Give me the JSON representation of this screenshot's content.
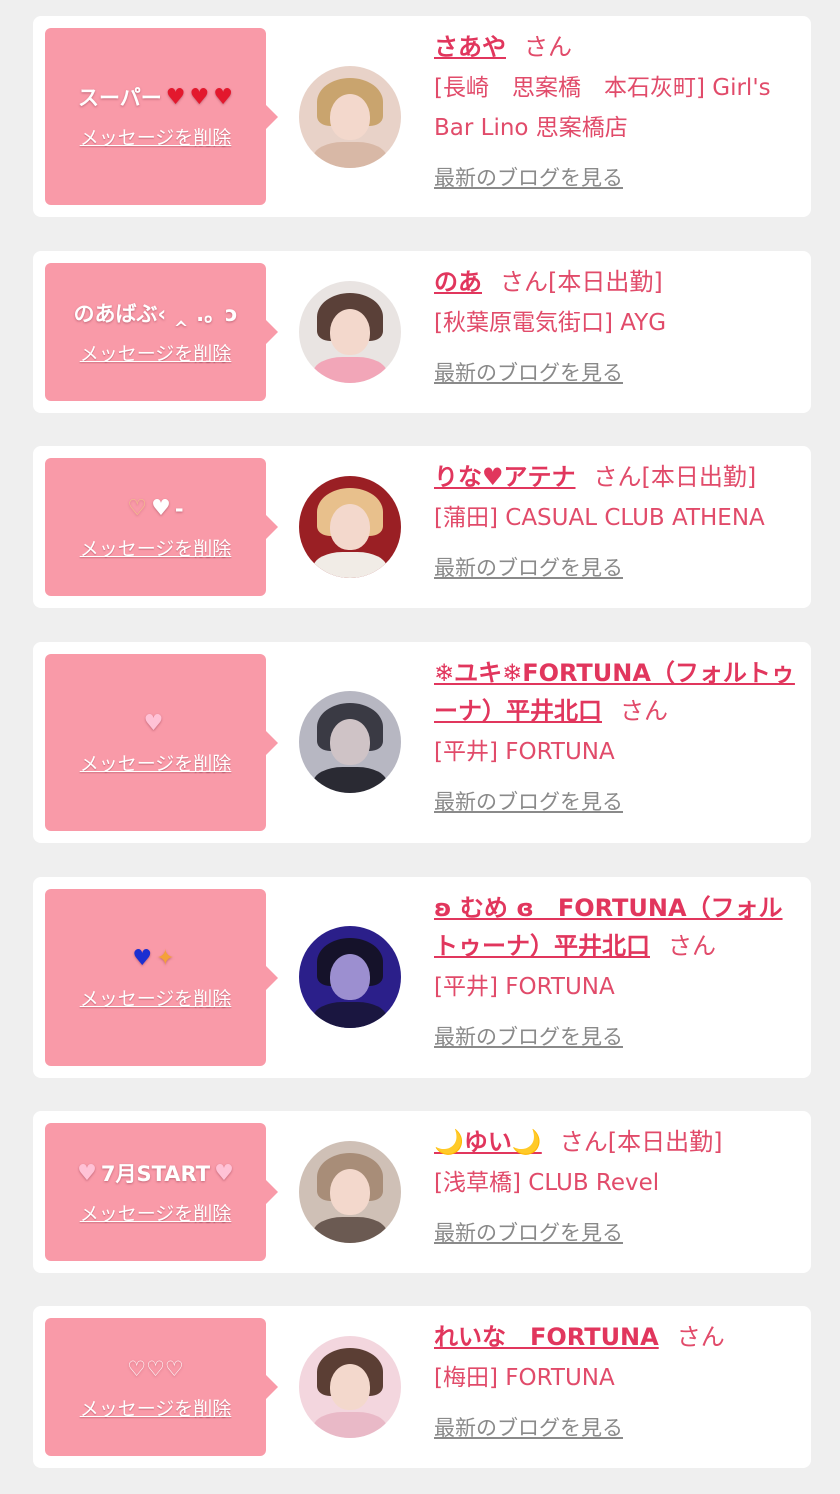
{
  "delete_label": "メッセージを削除",
  "san_label": "さん",
  "blog_label": "最新のブログを見る",
  "colors": {
    "bubble": "#f99aa8",
    "name": "#e1365d",
    "text": "#e14b6a",
    "link_gray": "#8a8a8a",
    "background": "#efefef"
  },
  "entries": [
    {
      "message_text": "スーパー",
      "message_icons": [
        "heart-icon",
        "heart-icon",
        "heart-icon"
      ],
      "name": "さあや",
      "status": "",
      "shop": "[長崎　思案橋　本石灰町] Girl's Bar Lino 思案橋店"
    },
    {
      "message_text": "のあばぶ‹ ‸ .。ↄ",
      "message_icons": [],
      "name": "のあ",
      "status": "[本日出勤]",
      "shop": "[秋葉原電気街口] AYG"
    },
    {
      "message_text": "-",
      "message_icons": [
        "heart-hands-icon",
        "white-heart-icon"
      ],
      "name": "りな♥アテナ",
      "status": "[本日出勤]",
      "shop": "[蒲田] CASUAL CLUB ATHENA"
    },
    {
      "message_text": "",
      "message_icons": [
        "pink-heart-icon"
      ],
      "name": "❄ユキ❄FORTUNA（フォルトゥーナ）平井北口",
      "status": "",
      "shop": "[平井] FORTUNA"
    },
    {
      "message_text": "",
      "message_icons": [
        "blue-heart-icon",
        "sparkle-icon"
      ],
      "name": "ʚ むめ ɞ　FORTUNA（フォルトゥーナ）平井北口",
      "status": "",
      "shop": "[平井] FORTUNA"
    },
    {
      "message_text": "7月START",
      "message_icons": [
        "pink-heart-icon",
        "pink-heart-icon"
      ],
      "name": "🌙ゆい🌙",
      "status": "[本日出勤]",
      "shop": "[浅草橋] CLUB Revel"
    },
    {
      "message_text": "♡♡♡",
      "message_icons": [],
      "name": "れいな　FORTUNA",
      "status": "",
      "shop": "[梅田] FORTUNA"
    }
  ]
}
